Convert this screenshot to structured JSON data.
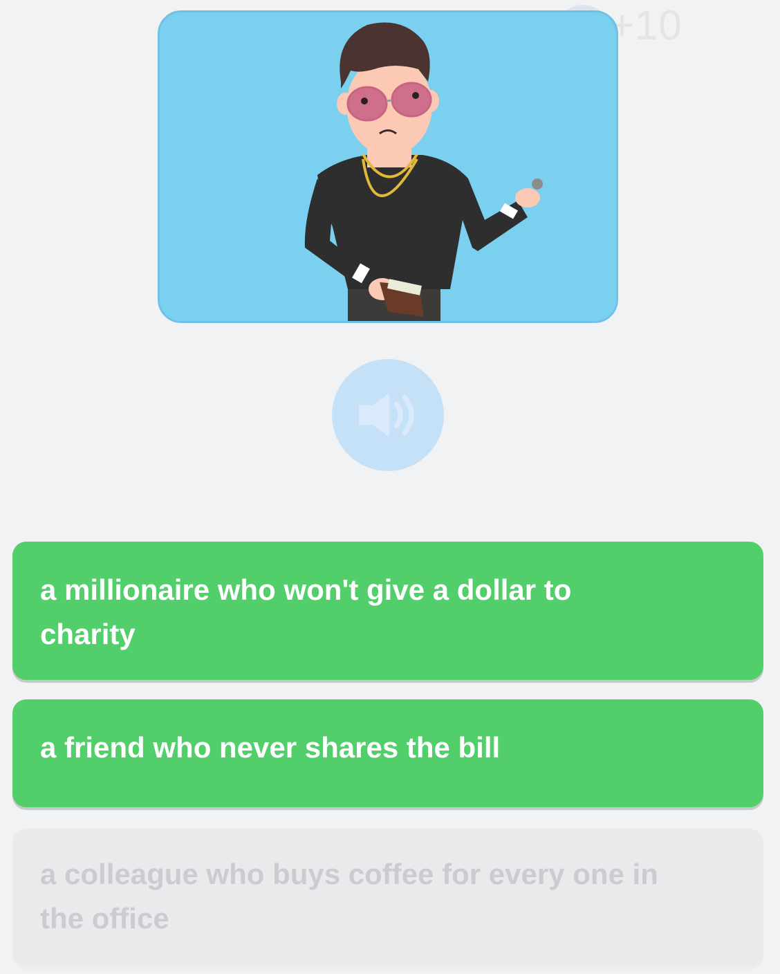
{
  "header": {
    "points_label": "+10"
  },
  "illustration": {
    "icon": "stingy-man-illustration",
    "background_color": "#7bd0f0"
  },
  "audio": {
    "icon": "speaker-icon"
  },
  "answers": [
    {
      "label": "a millionaire who won't give a dollar to charity",
      "state": "correct"
    },
    {
      "label": "a friend who never shares the bill",
      "state": "correct"
    },
    {
      "label": "a colleague who buys coffee for every one in the office",
      "state": "disabled"
    }
  ],
  "colors": {
    "correct": "#52ce6a",
    "disabled": "#e9eaec",
    "audio_button": "#c5e1f7"
  }
}
